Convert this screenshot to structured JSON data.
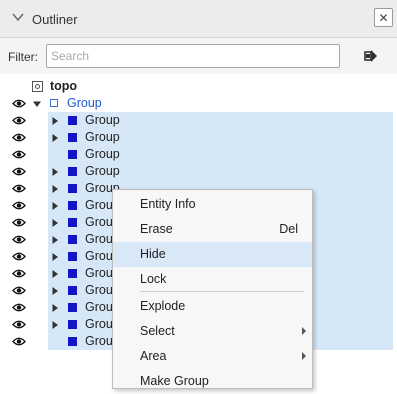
{
  "panel": {
    "title": "Outliner",
    "close_glyph": "✕"
  },
  "filter": {
    "label": "Filter:",
    "placeholder": "Search",
    "value": ""
  },
  "tree": {
    "root_label": "topo",
    "group_label": "Group",
    "children": [
      {
        "label": "Group",
        "expandable": true
      },
      {
        "label": "Group",
        "expandable": true
      },
      {
        "label": "Group",
        "expandable": false
      },
      {
        "label": "Group",
        "expandable": true
      },
      {
        "label": "Group",
        "expandable": true
      },
      {
        "label": "Group",
        "expandable": true
      },
      {
        "label": "Group",
        "expandable": true
      },
      {
        "label": "Group",
        "expandable": true
      },
      {
        "label": "Group",
        "expandable": true
      },
      {
        "label": "Group",
        "expandable": true
      },
      {
        "label": "Group",
        "expandable": true
      },
      {
        "label": "Group",
        "expandable": true
      },
      {
        "label": "Group",
        "expandable": true
      },
      {
        "label": "Group",
        "expandable": false
      }
    ]
  },
  "context_menu": {
    "entity_info": "Entity Info",
    "erase": "Erase",
    "erase_shortcut": "Del",
    "hide": "Hide",
    "lock": "Lock",
    "explode": "Explode",
    "select": "Select",
    "area": "Area",
    "make_group": "Make Group"
  },
  "colors": {
    "selection": "#d6e8f8",
    "component_square": "#1515c8",
    "group_text": "#1a5bd0"
  }
}
